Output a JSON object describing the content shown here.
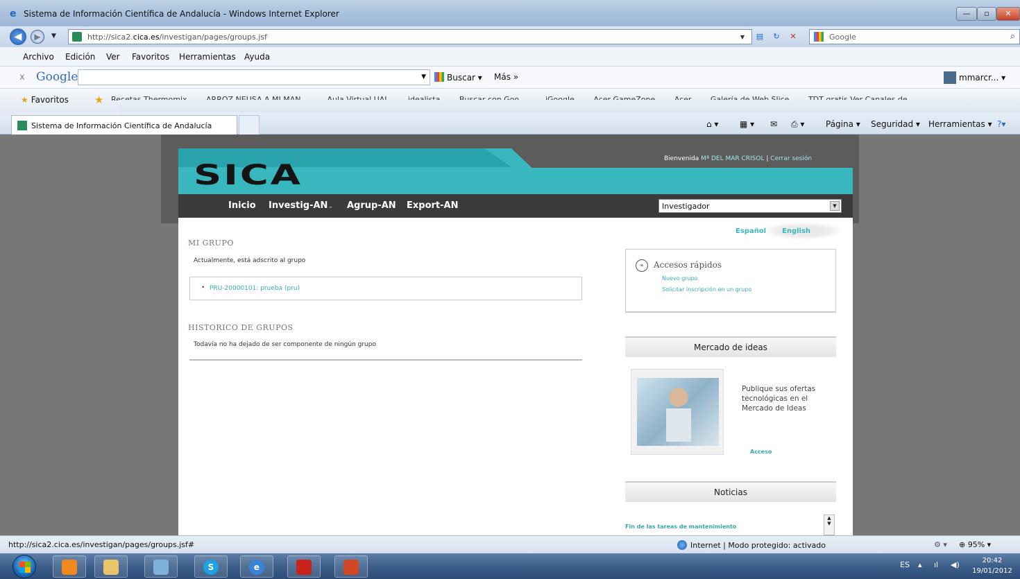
{
  "window": {
    "title": "Sistema de Información Científica de Andalucía - Windows Internet Explorer",
    "url_prefix": "http://sica2.",
    "url_host": "cica.es",
    "url_path": "/investigan/pages/groups.jsf",
    "search_engine": "Google"
  },
  "menu": [
    "Archivo",
    "Edición",
    "Ver",
    "Favoritos",
    "Herramientas",
    "Ayuda"
  ],
  "google_toolbar": {
    "close": "x",
    "logo": "Google",
    "buscar": "Buscar",
    "mas": "Más »",
    "user": "mmarcr..."
  },
  "favorites": {
    "label": "Favoritos",
    "links": [
      "Recetas Thermomix",
      "ARROZ NEUSA A MI MAN...",
      "Aula Virtual UAL",
      "idealista",
      "Buscar con Goo...",
      "iGoogle",
      "Acer GameZone",
      "Acer",
      "Galería de Web Slice",
      "TDT gratis Ver Canales de..."
    ]
  },
  "tab": {
    "label": "Sistema de Información Científica de Andalucía"
  },
  "command_bar": {
    "pagina": "Página",
    "seguridad": "Seguridad",
    "herramientas": "Herramientas"
  },
  "page": {
    "logo": "SICA",
    "welcome_label": "Bienvenida",
    "user_name": "Mª DEL MAR CRISOL",
    "separator": "|",
    "logout": "Cerrar sesión",
    "nav": [
      "Inicio",
      "Investig-AN",
      "Agrup-AN",
      "Export-AN"
    ],
    "role_select": "Investigador",
    "lang_es": "Español",
    "lang_en": "English",
    "mi_grupo": {
      "title": "MI GRUPO",
      "text": "Actualmente, está adscrito al grupo",
      "group_link": "PRU-20000101: prueba (pru)"
    },
    "historico": {
      "title": "HISTORICO DE GRUPOS",
      "text": "Todavía no ha dejado de ser componente de ningún grupo"
    },
    "quick_access": {
      "title": "Accesos rápidos",
      "links": [
        "Nuevo grupo",
        "Solicitar inscripción en un grupo"
      ]
    },
    "mercado": {
      "title": "Mercado de ideas",
      "text": "Publique sus ofertas tecnológicas en el Mercado de Ideas",
      "link": "Acceso"
    },
    "noticias": {
      "title": "Noticias",
      "item": "Fin de las tareas de mantenimiento"
    }
  },
  "status": {
    "url": "http://sica2.cica.es/investigan/pages/groups.jsf#",
    "zone": "Internet | Modo protegido: activado",
    "zoom": "95%"
  },
  "taskbar": {
    "lang": "ES",
    "time": "20:42",
    "date": "19/01/2012"
  }
}
